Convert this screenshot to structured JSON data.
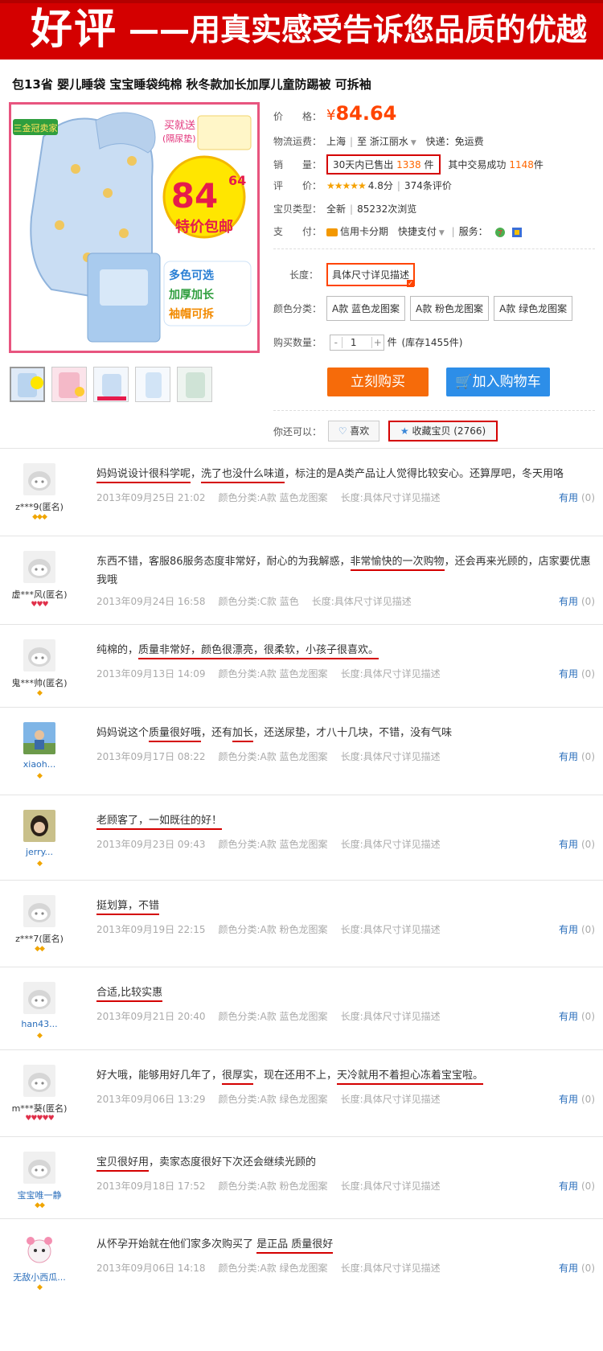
{
  "banner": {
    "big": "好评",
    "small": "——用真实感受告诉您品质的优越"
  },
  "product": {
    "title": "包13省 婴儿睡袋 宝宝睡袋纯棉 秋冬款加长加厚儿童防踢被 可拆袖",
    "image_text": {
      "badge": "三金冠卖家",
      "gift": "买就送",
      "gift_sub": "(隔尿垫)",
      "price_big": "84",
      "price_small": "64",
      "special": "特价包邮",
      "features": [
        "多色可选",
        "加厚加长",
        "袖帽可拆"
      ]
    }
  },
  "info": {
    "price_label": "价　　格：",
    "price_symbol": "¥",
    "price": "84.64",
    "shipping_label": "物流运费：",
    "ship_from": "上海",
    "ship_to_word": "至",
    "ship_to": "浙江丽水",
    "express": "快递：免运费",
    "sales_label": "销　　量：",
    "sales_prefix": "30天内已售出",
    "sales_count": "1338",
    "sales_unit": "件",
    "deal_prefix": "其中交易成功",
    "deal_count": "1148",
    "deal_unit": "件",
    "rating_label": "评　　价：",
    "rating_stars": "★★★★★",
    "rating_score": "4.8分",
    "rating_count": "374条评价",
    "type_label": "宝贝类型：",
    "type_value": "全新",
    "views": "85232次浏览",
    "pay_label": "支　　付：",
    "pay_installment": "信用卡分期",
    "pay_fast": "快捷支付",
    "service_label": "服务：",
    "length_label": "长度：",
    "length_option": "具体尺寸详见描述",
    "color_label": "颜色分类：",
    "color_options": [
      "A款 蓝色龙图案",
      "A款 粉色龙图案",
      "A款 绿色龙图案"
    ],
    "qty_label": "购买数量：",
    "qty_minus": "-",
    "qty_value": "1",
    "qty_plus": "+",
    "qty_unit": "件",
    "stock": "(库存1455件)",
    "buy_button": "立刻购买",
    "cart_button": "加入购物车",
    "can_do": "你还可以：",
    "like_button": "喜欢",
    "fav_button": "收藏宝贝 (2766)"
  },
  "reviews": [
    {
      "user": "z***9(匿名)",
      "badge": "◆◆◆",
      "badge_color": "gold",
      "text_parts": [
        {
          "t": "妈妈说设计很科学呢",
          "u": true
        },
        {
          "t": "，",
          "u": false
        },
        {
          "t": "洗了也没什么味道",
          "u": true
        },
        {
          "t": "，标注的是A类产品让人觉得比较安心。还算厚吧，冬天用咯",
          "u": false
        }
      ],
      "date": "2013年09月25日 21:02",
      "color": "颜色分类:A款 蓝色龙图案",
      "length": "长度:具体尺寸详见描述",
      "useful": "有用",
      "useful_count": "(0)"
    },
    {
      "user": "虚***风(匿名)",
      "badge": "♥♥♥",
      "badge_color": "red",
      "text_parts": [
        {
          "t": "东西不错，客服86服务态度非常好，耐心的为我解惑，",
          "u": false
        },
        {
          "t": "非常愉快的一次购物",
          "u": true
        },
        {
          "t": "，还会再来光顾的，店家要优惠我哦",
          "u": false
        }
      ],
      "date": "2013年09月24日 16:58",
      "color": "颜色分类:C款 蓝色",
      "length": "长度:具体尺寸详见描述",
      "useful": "有用",
      "useful_count": "(0)"
    },
    {
      "user": "鬼***帅(匿名)",
      "badge": "◆",
      "badge_color": "gold",
      "text_parts": [
        {
          "t": "纯棉的，",
          "u": false
        },
        {
          "t": "质量非常好，颜色很漂亮，很柔软，小孩子很喜欢。",
          "u": true
        }
      ],
      "date": "2013年09月13日 14:09",
      "color": "颜色分类:A款 蓝色龙图案",
      "length": "长度:具体尺寸详见描述",
      "useful": "有用",
      "useful_count": "(0)"
    },
    {
      "user": "xiaoh...",
      "badge": "◆",
      "badge_color": "gold",
      "text_parts": [
        {
          "t": "妈妈说这个",
          "u": false
        },
        {
          "t": "质量很好哦",
          "u": true
        },
        {
          "t": "，还有",
          "u": false
        },
        {
          "t": "加长",
          "u": true
        },
        {
          "t": "，还送尿垫，才八十几块，不错，没有气味",
          "u": false
        }
      ],
      "date": "2013年09月17日 08:22",
      "color": "颜色分类:A款 蓝色龙图案",
      "length": "长度:具体尺寸详见描述",
      "useful": "有用",
      "useful_count": "(0)"
    },
    {
      "user": "jerry...",
      "badge": "◆",
      "badge_color": "gold",
      "text_parts": [
        {
          "t": "老顾客了，一如既往的好！",
          "u": true
        }
      ],
      "date": "2013年09月23日 09:43",
      "color": "颜色分类:A款 蓝色龙图案",
      "length": "长度:具体尺寸详见描述",
      "useful": "有用",
      "useful_count": "(0)"
    },
    {
      "user": "z***7(匿名)",
      "badge": "◆◆",
      "badge_color": "gold",
      "text_parts": [
        {
          "t": "挺划算，不错",
          "u": true
        }
      ],
      "date": "2013年09月19日 22:15",
      "color": "颜色分类:A款 粉色龙图案",
      "length": "长度:具体尺寸详见描述",
      "useful": "有用",
      "useful_count": "(0)"
    },
    {
      "user": "han43...",
      "badge": "◆",
      "badge_color": "gold",
      "text_parts": [
        {
          "t": "合适,比较实惠",
          "u": true
        }
      ],
      "date": "2013年09月21日 20:40",
      "color": "颜色分类:A款 蓝色龙图案",
      "length": "长度:具体尺寸详见描述",
      "useful": "有用",
      "useful_count": "(0)"
    },
    {
      "user": "m***葵(匿名)",
      "badge": "♥♥♥♥♥",
      "badge_color": "red",
      "text_parts": [
        {
          "t": "好大哦，能够用好几年了，",
          "u": false
        },
        {
          "t": "很厚实",
          "u": true
        },
        {
          "t": "，现在还用不上，",
          "u": false
        },
        {
          "t": "天冷就用不着担心冻着宝宝啦。",
          "u": true
        }
      ],
      "date": "2013年09月06日 13:29",
      "color": "颜色分类:A款 绿色龙图案",
      "length": "长度:具体尺寸详见描述",
      "useful": "有用",
      "useful_count": "(0)"
    },
    {
      "user": "宝宝唯一静",
      "badge": "◆◆",
      "badge_color": "gold",
      "text_parts": [
        {
          "t": "宝贝很好用",
          "u": true
        },
        {
          "t": "，卖家态度很好下次还会继续光顾的",
          "u": false
        }
      ],
      "date": "2013年09月18日 17:52",
      "color": "颜色分类:A款 粉色龙图案",
      "length": "长度:具体尺寸详见描述",
      "useful": "有用",
      "useful_count": "(0)"
    },
    {
      "user": "无敌小西瓜...",
      "badge": "◆",
      "badge_color": "gold",
      "text_parts": [
        {
          "t": "从怀孕开始就在他们家多次购买了 ",
          "u": false
        },
        {
          "t": "是正品 质量很好",
          "u": true
        }
      ],
      "date": "2013年09月06日 14:18",
      "color": "颜色分类:A款 绿色龙图案",
      "length": "长度:具体尺寸详见描述",
      "useful": "有用",
      "useful_count": "(0)"
    }
  ]
}
